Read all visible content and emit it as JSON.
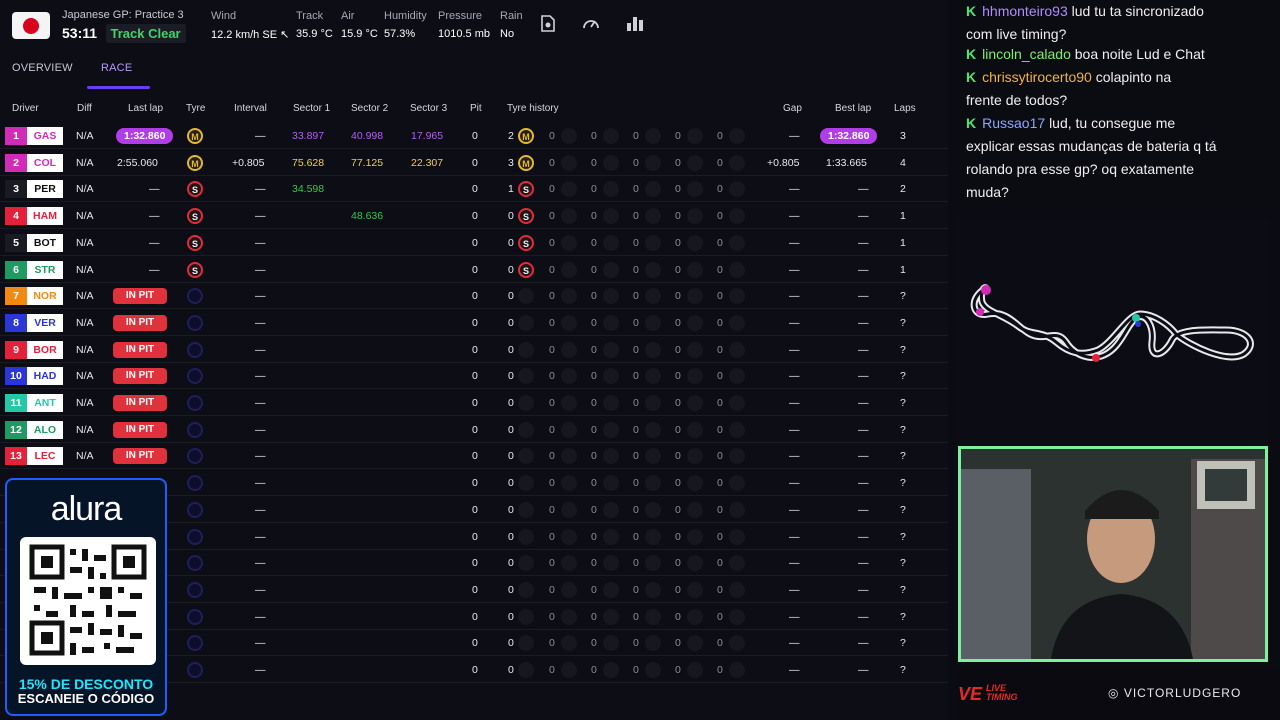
{
  "session": {
    "country_flag": "japan-flag",
    "name": "Japanese GP: Practice 3",
    "clock": "53:11",
    "status": "Track Clear"
  },
  "weather": [
    {
      "label": "Wind",
      "value": "12.2 km/h SE ↖"
    },
    {
      "label": "Track",
      "value": "35.9 °C"
    },
    {
      "label": "Air",
      "value": "15.9 °C"
    },
    {
      "label": "Humidity",
      "value": "57.3%"
    },
    {
      "label": "Pressure",
      "value": "1010.5 mb"
    },
    {
      "label": "Rain",
      "value": "No"
    }
  ],
  "toolbar_icons": [
    "document-icon",
    "speedometer-icon",
    "bar-chart-icon"
  ],
  "tabs": [
    {
      "label": "OVERVIEW",
      "active": false
    },
    {
      "label": "RACE",
      "active": true
    }
  ],
  "columns": {
    "driver": "Driver",
    "diff": "Diff",
    "last_lap": "Last lap",
    "tyre": "Tyre",
    "interval": "Interval",
    "s1": "Sector 1",
    "s2": "Sector 2",
    "s3": "Sector 3",
    "pit": "Pit",
    "tyre_history": "Tyre history",
    "gap": "Gap",
    "best_lap": "Best lap",
    "laps": "Laps"
  },
  "rows": [
    {
      "pos": "1",
      "code": "GAS",
      "color": "#d12cb7",
      "diff": "N/A",
      "last_lap": "1:32.860",
      "last_style": "pill",
      "tyre": "M",
      "interval": "—",
      "s1": "33.897",
      "s1c": "purple",
      "s2": "40.998",
      "s2c": "purple",
      "s3": "17.965",
      "s3c": "purple",
      "pit": "0",
      "hist_n": "2",
      "hist_tyre": "M",
      "hist": [
        "0",
        "0",
        "0",
        "0",
        "0"
      ],
      "gap": "—",
      "best": "1:32.860",
      "best_style": "pill",
      "laps": "3"
    },
    {
      "pos": "2",
      "code": "COL",
      "color": "#d12cb7",
      "diff": "N/A",
      "last_lap": "2:55.060",
      "last_style": "",
      "tyre": "M",
      "interval": "+0.805",
      "s1": "75.628",
      "s1c": "yellow",
      "s2": "77.125",
      "s2c": "yellow",
      "s3": "22.307",
      "s3c": "yellow",
      "pit": "0",
      "hist_n": "3",
      "hist_tyre": "M",
      "hist": [
        "0",
        "0",
        "0",
        "0",
        "0"
      ],
      "gap": "+0.805",
      "best": "1:33.665",
      "best_style": "",
      "laps": "4"
    },
    {
      "pos": "3",
      "code": "PER",
      "color": "#1a1a22",
      "diff": "N/A",
      "last_lap": "—",
      "last_style": "",
      "tyre": "S",
      "interval": "—",
      "s1": "34.598",
      "s1c": "green",
      "s2": "",
      "s2c": "",
      "s3": "",
      "s3c": "",
      "pit": "0",
      "hist_n": "1",
      "hist_tyre": "S",
      "hist": [
        "0",
        "0",
        "0",
        "0",
        "0"
      ],
      "gap": "—",
      "best": "—",
      "best_style": "",
      "laps": "2"
    },
    {
      "pos": "4",
      "code": "HAM",
      "color": "#e3213a",
      "diff": "N/A",
      "last_lap": "—",
      "last_style": "",
      "tyre": "S",
      "interval": "—",
      "s1": "",
      "s1c": "",
      "s2": "48.636",
      "s2c": "green",
      "s3": "",
      "s3c": "",
      "pit": "0",
      "hist_n": "0",
      "hist_tyre": "S",
      "hist": [
        "0",
        "0",
        "0",
        "0",
        "0"
      ],
      "gap": "—",
      "best": "—",
      "best_style": "",
      "laps": "1"
    },
    {
      "pos": "5",
      "code": "BOT",
      "color": "#1a1a22",
      "diff": "N/A",
      "last_lap": "—",
      "last_style": "",
      "tyre": "S",
      "interval": "—",
      "s1": "",
      "s1c": "",
      "s2": "",
      "s2c": "",
      "s3": "",
      "s3c": "",
      "pit": "0",
      "hist_n": "0",
      "hist_tyre": "S",
      "hist": [
        "0",
        "0",
        "0",
        "0",
        "0"
      ],
      "gap": "—",
      "best": "—",
      "best_style": "",
      "laps": "1"
    },
    {
      "pos": "6",
      "code": "STR",
      "color": "#1f9a62",
      "diff": "N/A",
      "last_lap": "—",
      "last_style": "",
      "tyre": "S",
      "interval": "—",
      "s1": "",
      "s1c": "",
      "s2": "",
      "s2c": "",
      "s3": "",
      "s3c": "",
      "pit": "0",
      "hist_n": "0",
      "hist_tyre": "S",
      "hist": [
        "0",
        "0",
        "0",
        "0",
        "0"
      ],
      "gap": "—",
      "best": "—",
      "best_style": "",
      "laps": "1"
    },
    {
      "pos": "7",
      "code": "NOR",
      "color": "#f28a11",
      "diff": "N/A",
      "last_lap": "IN PIT",
      "last_style": "pit",
      "tyre": "",
      "interval": "—",
      "s1": "",
      "s1c": "",
      "s2": "",
      "s2c": "",
      "s3": "",
      "s3c": "",
      "pit": "0",
      "hist_n": "0",
      "hist_tyre": "",
      "hist": [
        "0",
        "0",
        "0",
        "0",
        "0"
      ],
      "gap": "—",
      "best": "—",
      "best_style": "",
      "laps": "?"
    },
    {
      "pos": "8",
      "code": "VER",
      "color": "#2a36d6",
      "diff": "N/A",
      "last_lap": "IN PIT",
      "last_style": "pit",
      "tyre": "",
      "interval": "—",
      "s1": "",
      "s1c": "",
      "s2": "",
      "s2c": "",
      "s3": "",
      "s3c": "",
      "pit": "0",
      "hist_n": "0",
      "hist_tyre": "",
      "hist": [
        "0",
        "0",
        "0",
        "0",
        "0"
      ],
      "gap": "—",
      "best": "—",
      "best_style": "",
      "laps": "?"
    },
    {
      "pos": "9",
      "code": "BOR",
      "color": "#e3213a",
      "diff": "N/A",
      "last_lap": "IN PIT",
      "last_style": "pit",
      "tyre": "",
      "interval": "—",
      "s1": "",
      "s1c": "",
      "s2": "",
      "s2c": "",
      "s3": "",
      "s3c": "",
      "pit": "0",
      "hist_n": "0",
      "hist_tyre": "",
      "hist": [
        "0",
        "0",
        "0",
        "0",
        "0"
      ],
      "gap": "—",
      "best": "—",
      "best_style": "",
      "laps": "?"
    },
    {
      "pos": "10",
      "code": "HAD",
      "color": "#2a36d6",
      "diff": "N/A",
      "last_lap": "IN PIT",
      "last_style": "pit",
      "tyre": "",
      "interval": "—",
      "s1": "",
      "s1c": "",
      "s2": "",
      "s2c": "",
      "s3": "",
      "s3c": "",
      "pit": "0",
      "hist_n": "0",
      "hist_tyre": "",
      "hist": [
        "0",
        "0",
        "0",
        "0",
        "0"
      ],
      "gap": "—",
      "best": "—",
      "best_style": "",
      "laps": "?"
    },
    {
      "pos": "11",
      "code": "ANT",
      "color": "#24c8a6",
      "diff": "N/A",
      "last_lap": "IN PIT",
      "last_style": "pit",
      "tyre": "",
      "interval": "—",
      "s1": "",
      "s1c": "",
      "s2": "",
      "s2c": "",
      "s3": "",
      "s3c": "",
      "pit": "0",
      "hist_n": "0",
      "hist_tyre": "",
      "hist": [
        "0",
        "0",
        "0",
        "0",
        "0"
      ],
      "gap": "—",
      "best": "—",
      "best_style": "",
      "laps": "?"
    },
    {
      "pos": "12",
      "code": "ALO",
      "color": "#1f9a62",
      "diff": "N/A",
      "last_lap": "IN PIT",
      "last_style": "pit",
      "tyre": "",
      "interval": "—",
      "s1": "",
      "s1c": "",
      "s2": "",
      "s2c": "",
      "s3": "",
      "s3c": "",
      "pit": "0",
      "hist_n": "0",
      "hist_tyre": "",
      "hist": [
        "0",
        "0",
        "0",
        "0",
        "0"
      ],
      "gap": "—",
      "best": "—",
      "best_style": "",
      "laps": "?"
    },
    {
      "pos": "13",
      "code": "LEC",
      "color": "#e3213a",
      "diff": "N/A",
      "last_lap": "IN PIT",
      "last_style": "pit",
      "tyre": "",
      "interval": "—",
      "s1": "",
      "s1c": "",
      "s2": "",
      "s2c": "",
      "s3": "",
      "s3c": "",
      "pit": "0",
      "hist_n": "0",
      "hist_tyre": "",
      "hist": [
        "0",
        "0",
        "0",
        "0",
        "0"
      ],
      "gap": "—",
      "best": "—",
      "best_style": "",
      "laps": "?"
    },
    {
      "pos": "",
      "code": "",
      "color": "#0d0d15",
      "diff": "",
      "last_lap": "",
      "last_style": "",
      "tyre": "",
      "interval": "—",
      "s1": "",
      "s1c": "",
      "s2": "",
      "s2c": "",
      "s3": "",
      "s3c": "",
      "pit": "0",
      "hist_n": "0",
      "hist_tyre": "",
      "hist": [
        "0",
        "0",
        "0",
        "0",
        "0"
      ],
      "gap": "—",
      "best": "—",
      "best_style": "",
      "laps": "?"
    },
    {
      "pos": "",
      "code": "",
      "color": "#0d0d15",
      "diff": "",
      "last_lap": "",
      "last_style": "",
      "tyre": "",
      "interval": "—",
      "s1": "",
      "s1c": "",
      "s2": "",
      "s2c": "",
      "s3": "",
      "s3c": "",
      "pit": "0",
      "hist_n": "0",
      "hist_tyre": "",
      "hist": [
        "0",
        "0",
        "0",
        "0",
        "0"
      ],
      "gap": "—",
      "best": "—",
      "best_style": "",
      "laps": "?"
    },
    {
      "pos": "",
      "code": "",
      "color": "#0d0d15",
      "diff": "",
      "last_lap": "",
      "last_style": "",
      "tyre": "",
      "interval": "—",
      "s1": "",
      "s1c": "",
      "s2": "",
      "s2c": "",
      "s3": "",
      "s3c": "",
      "pit": "0",
      "hist_n": "0",
      "hist_tyre": "",
      "hist": [
        "0",
        "0",
        "0",
        "0",
        "0"
      ],
      "gap": "—",
      "best": "—",
      "best_style": "",
      "laps": "?"
    },
    {
      "pos": "",
      "code": "",
      "color": "#0d0d15",
      "diff": "",
      "last_lap": "",
      "last_style": "",
      "tyre": "",
      "interval": "—",
      "s1": "",
      "s1c": "",
      "s2": "",
      "s2c": "",
      "s3": "",
      "s3c": "",
      "pit": "0",
      "hist_n": "0",
      "hist_tyre": "",
      "hist": [
        "0",
        "0",
        "0",
        "0",
        "0"
      ],
      "gap": "—",
      "best": "—",
      "best_style": "",
      "laps": "?"
    },
    {
      "pos": "",
      "code": "",
      "color": "#0d0d15",
      "diff": "",
      "last_lap": "",
      "last_style": "",
      "tyre": "",
      "interval": "—",
      "s1": "",
      "s1c": "",
      "s2": "",
      "s2c": "",
      "s3": "",
      "s3c": "",
      "pit": "0",
      "hist_n": "0",
      "hist_tyre": "",
      "hist": [
        "0",
        "0",
        "0",
        "0",
        "0"
      ],
      "gap": "—",
      "best": "—",
      "best_style": "",
      "laps": "?"
    },
    {
      "pos": "",
      "code": "",
      "color": "#0d0d15",
      "diff": "",
      "last_lap": "",
      "last_style": "",
      "tyre": "",
      "interval": "—",
      "s1": "",
      "s1c": "",
      "s2": "",
      "s2c": "",
      "s3": "",
      "s3c": "",
      "pit": "0",
      "hist_n": "0",
      "hist_tyre": "",
      "hist": [
        "0",
        "0",
        "0",
        "0",
        "0"
      ],
      "gap": "—",
      "best": "—",
      "best_style": "",
      "laps": "?"
    },
    {
      "pos": "",
      "code": "",
      "color": "#0d0d15",
      "diff": "",
      "last_lap": "",
      "last_style": "",
      "tyre": "",
      "interval": "—",
      "s1": "",
      "s1c": "",
      "s2": "",
      "s2c": "",
      "s3": "",
      "s3c": "",
      "pit": "0",
      "hist_n": "0",
      "hist_tyre": "",
      "hist": [
        "0",
        "0",
        "0",
        "0",
        "0"
      ],
      "gap": "—",
      "best": "—",
      "best_style": "",
      "laps": "?"
    },
    {
      "pos": "",
      "code": "",
      "color": "#0d0d15",
      "diff": "",
      "last_lap": "",
      "last_style": "",
      "tyre": "",
      "interval": "—",
      "s1": "",
      "s1c": "",
      "s2": "",
      "s2c": "",
      "s3": "",
      "s3c": "",
      "pit": "0",
      "hist_n": "0",
      "hist_tyre": "",
      "hist": [
        "0",
        "0",
        "0",
        "0",
        "0"
      ],
      "gap": "—",
      "best": "—",
      "best_style": "",
      "laps": "?"
    }
  ],
  "alura": {
    "logo": "alura",
    "promo": "15% DE DESCONTO",
    "scan": "ESCANEIE O CÓDIGO"
  },
  "chat": [
    {
      "user": "hhmonteiro93",
      "color": "#b08cff",
      "lines": [
        "lud tu ta sincronizado",
        "com live timing?"
      ],
      "first_inline": true
    },
    {
      "user": "lincoln_calado",
      "color": "#7cf06a",
      "lines": [
        "boa noite Lud e Chat"
      ],
      "first_inline": true
    },
    {
      "user": "chrissytirocerto90",
      "color": "#f6b23c",
      "lines": [
        "colapinto na",
        "frente de todos?"
      ],
      "first_inline": true
    },
    {
      "user": "Russao17",
      "color": "#8aa7ff",
      "lines": [
        "lud, tu consegue me",
        "explicar essas mudanças de bateria q tá",
        "rolando pra esse gp? oq exatamente",
        "muda?"
      ],
      "first_inline": true
    }
  ],
  "footer": {
    "brand": "VE",
    "brand_sub": "LIVE\nTIMING",
    "instagram": "VICTORLUDGERO"
  }
}
